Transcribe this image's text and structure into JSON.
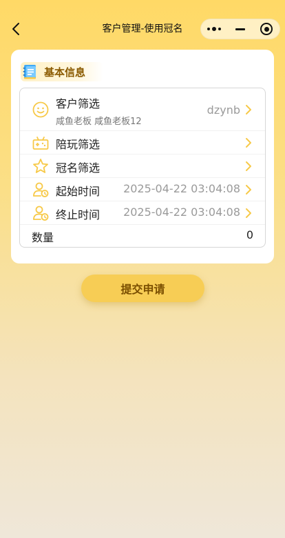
{
  "nav": {
    "title": "客户管理-使用冠名"
  },
  "section": {
    "title": "基本信息"
  },
  "form": {
    "customer": {
      "label": "客户筛选",
      "sub": "咸鱼老板 咸鱼老板12",
      "value": "dzynb"
    },
    "companion": {
      "label": "陪玩筛选"
    },
    "title_name": {
      "label": "冠名筛选"
    },
    "start_time": {
      "label": "起始时间",
      "value": "2025-04-22 03:04:08"
    },
    "end_time": {
      "label": "终止时间",
      "value": "2025-04-22 03:04:08"
    },
    "quantity": {
      "label": "数量",
      "value": "0"
    }
  },
  "submit": {
    "label": "提交申请"
  },
  "colors": {
    "accent": "#F7C948",
    "button": "#F7CD55",
    "section_text": "#8A5A00"
  },
  "icons": {
    "back": "chevron-left-icon",
    "more": "more-dots-icon",
    "minimize": "minus-icon",
    "close": "target-circle-icon",
    "section": "notebook-icon",
    "customer": "smiley-face-icon",
    "companion": "gamepad-icon",
    "title_name": "star-icon",
    "start_time": "user-clock-icon",
    "end_time": "user-clock-icon",
    "row_arrow": "chevron-right-icon"
  }
}
